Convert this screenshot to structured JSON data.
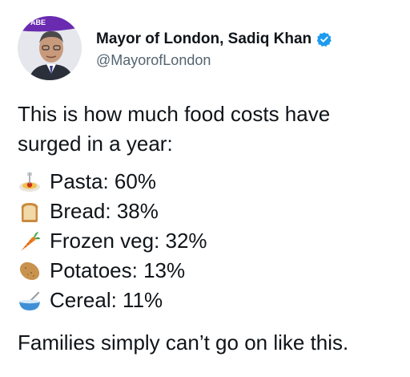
{
  "author": {
    "display_name": "Mayor of London, Sadiq Khan",
    "handle": "@MayorofLondon",
    "avatar_badge_text": "ABE",
    "verified": true,
    "verified_color": "#1d9bf0"
  },
  "tweet": {
    "intro": "This is how much food costs have\nsurged in a year:",
    "items": [
      {
        "emoji": "spaghetti-icon",
        "text": "Pasta: 60%"
      },
      {
        "emoji": "bread-icon",
        "text": "Bread: 38%"
      },
      {
        "emoji": "carrot-icon",
        "text": "Frozen veg: 32%"
      },
      {
        "emoji": "potato-icon",
        "text": "Potatoes: 13%"
      },
      {
        "emoji": "bowl-with-spoon-icon",
        "text": "Cereal: 11%"
      }
    ],
    "outro": "Families simply can’t go on like this."
  },
  "colors": {
    "text": "#0f1419",
    "secondary_text": "#536471",
    "avatar_banner": "#6a2bb0"
  }
}
